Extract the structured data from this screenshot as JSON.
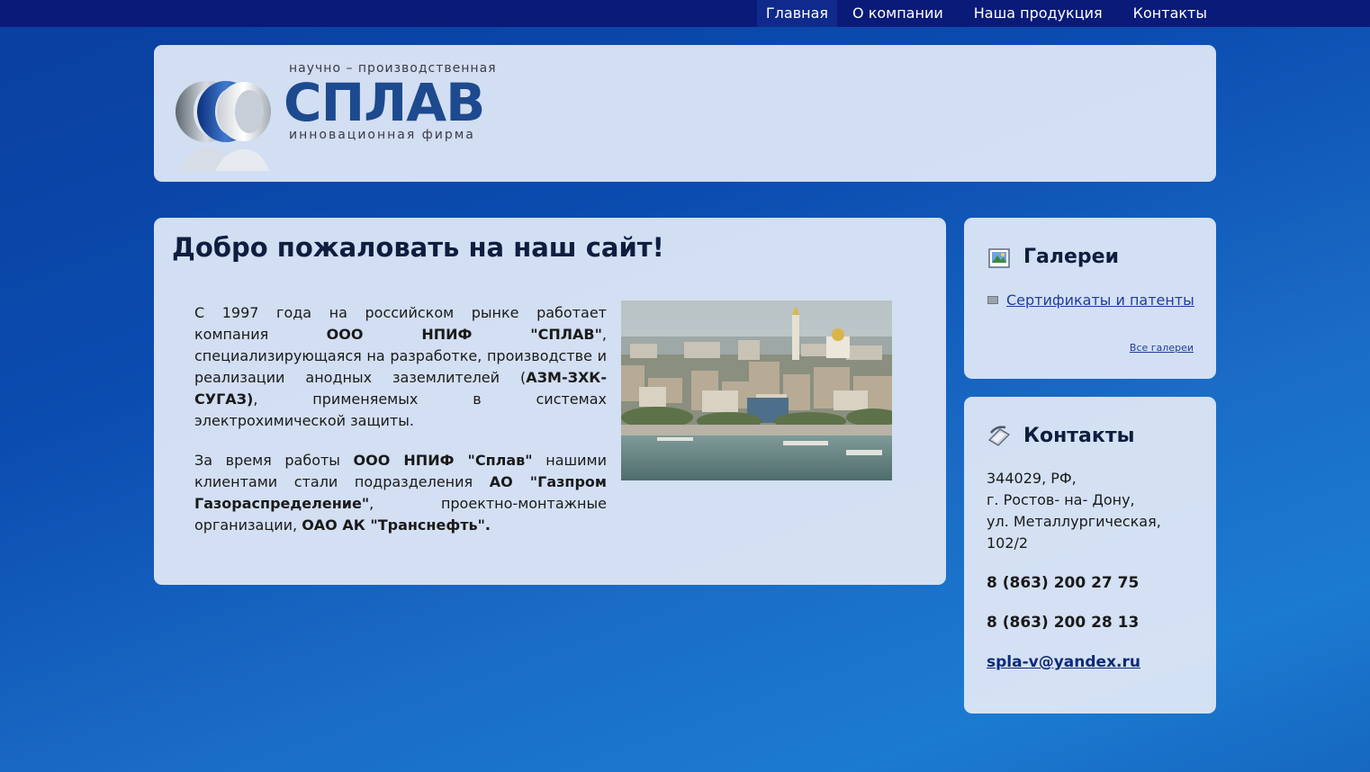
{
  "nav": {
    "items": [
      {
        "label": "Главная",
        "active": true
      },
      {
        "label": "О компании"
      },
      {
        "label": "Наша продукция"
      },
      {
        "label": "Контакты"
      }
    ]
  },
  "logo": {
    "top_text": "научно – производственная",
    "name": "СПЛАВ",
    "bottom_text": "инновационная фирма"
  },
  "main": {
    "title": "Добро пожаловать на наш сайт!",
    "p1": {
      "a": "С 1997 года на российском рынке работает компания ",
      "b": "ООО НПИФ \"СПЛАВ\"",
      "c": ", специализирующаяся на разработке, производстве и реализации анодных заземлителей (",
      "d": "АЗМ-ЗХК-СУГАЗ)",
      "e": ", применяемых в системах электрохимической защиты."
    },
    "p2": {
      "a": "За время работы ",
      "b": "ООО НПИФ \"Сплав\"",
      "c": " нашими клиентами стали подразделения ",
      "d": "АО \"Газпром Газораспределение\"",
      "e": ", проектно-монтажные организации, ",
      "f": "ОАО АК \"Транснефть\"."
    }
  },
  "galleries": {
    "title": "Галереи",
    "link": "Сертификаты и патенты",
    "all": "Все галереи"
  },
  "contacts": {
    "title": "Контакты",
    "address": [
      "344029, РФ,",
      "г. Ростов- на- Дону,",
      "ул. Металлургическая,",
      "102/2"
    ],
    "phone1": "8 (863) 200 27 75",
    "phone2": "8 (863) 200 28 13",
    "email": "spla-v@yandex.ru"
  }
}
